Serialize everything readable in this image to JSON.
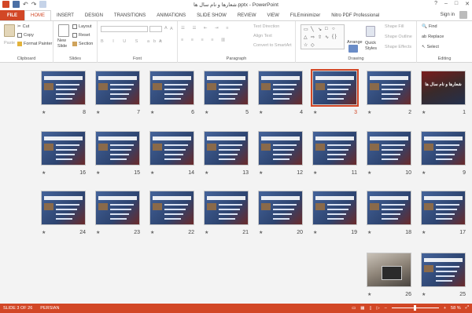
{
  "window": {
    "title": "شعارها و نام سال ها.pptx - PowerPoint",
    "controls": [
      "?",
      "–",
      "□",
      "✕"
    ]
  },
  "tabs": [
    "FILE",
    "HOME",
    "INSERT",
    "DESIGN",
    "TRANSITIONS",
    "ANIMATIONS",
    "SLIDE SHOW",
    "REVIEW",
    "VIEW",
    "FILEminimizer",
    "Nitro PDF Professional"
  ],
  "account": {
    "signin": "Sign in"
  },
  "ribbon": {
    "clipboard": {
      "label": "Clipboard",
      "paste": "Paste",
      "cut": "Cut",
      "copy": "Copy",
      "format_painter": "Format Painter"
    },
    "slides": {
      "label": "Slides",
      "new_slide": "New",
      "new_slide2": "Slide",
      "layout": "Layout",
      "reset": "Reset",
      "section": "Section"
    },
    "font": {
      "label": "Font"
    },
    "paragraph": {
      "label": "Paragraph",
      "text_direction": "Text Direction",
      "align_text": "Align Text",
      "convert_smartart": "Convert to SmartArt"
    },
    "drawing": {
      "label": "Drawing",
      "arrange": "Arrange",
      "quick_styles": "Quick",
      "quick_styles2": "Styles",
      "shape_fill": "Shape Fill",
      "shape_outline": "Shape Outline",
      "shape_effects": "Shape Effects"
    },
    "editing": {
      "label": "Editing",
      "find": "Find",
      "replace": "Replace",
      "select": "Select"
    }
  },
  "slides": {
    "selected": "3",
    "title_slide_text": "شعارها و نام سال ها",
    "numbers": [
      "1",
      "2",
      "3",
      "4",
      "5",
      "6",
      "7",
      "8",
      "9",
      "10",
      "11",
      "12",
      "13",
      "14",
      "15",
      "16",
      "17",
      "18",
      "19",
      "20",
      "21",
      "22",
      "23",
      "24",
      "25",
      "26"
    ],
    "star": "★"
  },
  "status": {
    "slide_of": "SLIDE 3 OF 26",
    "language": "PERSIAN",
    "zoom": "58 %"
  },
  "colors": {
    "accent": "#d24726",
    "status_bar": "#d24726"
  }
}
